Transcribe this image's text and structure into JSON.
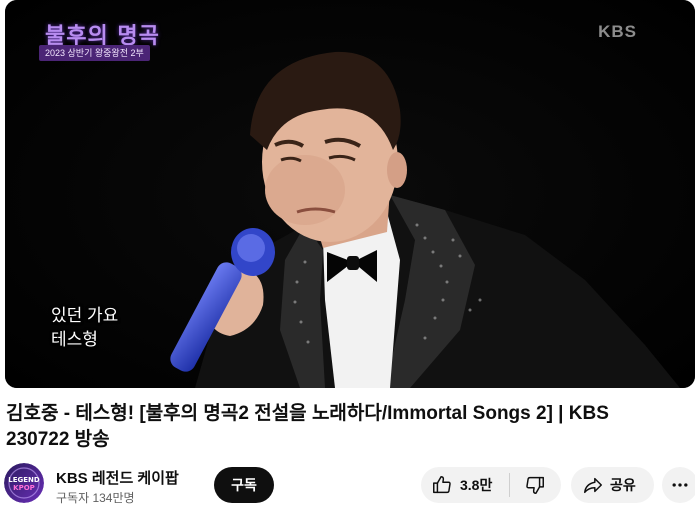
{
  "video": {
    "show_logo_title": "불후의 명곡",
    "show_logo_subtitle": "2023 상반기 왕중왕전 2부",
    "broadcaster_watermark": "KBS",
    "subtitle_lines": [
      "있던 가요",
      "테스형"
    ]
  },
  "title": "김호중 - 테스형! [불후의 명곡2 전설을 노래하다/Immortal Songs 2] | KBS 230722 방송",
  "channel": {
    "name": "KBS 레전드 케이팝",
    "subscribers": "구독자 134만명",
    "avatar_text": "LEGEND KPOP"
  },
  "actions": {
    "subscribe_label": "구독",
    "like_count": "3.8만",
    "share_label": "공유"
  },
  "icons": {
    "like": "thumbs-up-icon",
    "dislike": "thumbs-down-icon",
    "share": "share-arrow-icon",
    "more": "more-horizontal-icon"
  },
  "colors": {
    "subscribe_bg": "#0f0f0f",
    "pill_bg": "#f2f2f2",
    "logo_purple": "#b88cf0"
  }
}
